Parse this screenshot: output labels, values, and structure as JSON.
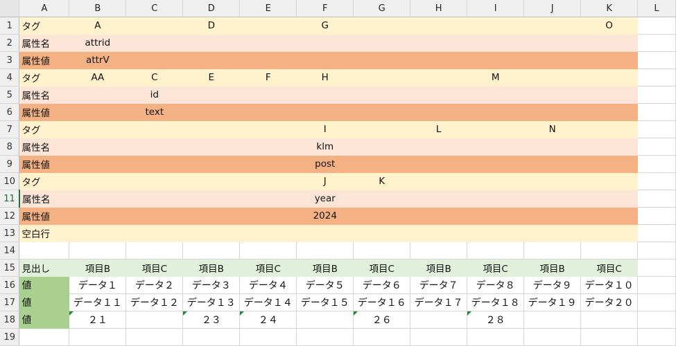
{
  "columns": [
    "A",
    "B",
    "C",
    "D",
    "E",
    "F",
    "G",
    "H",
    "I",
    "J",
    "K",
    "L"
  ],
  "bands": [
    "tag",
    "name",
    "val",
    "tag",
    "name",
    "val",
    "tag",
    "name",
    "val",
    "tag",
    "name",
    "val",
    "blank",
    "empty",
    "head",
    "data",
    "data",
    "data",
    "empty"
  ],
  "rows": [
    {
      "n": "1",
      "cells": [
        "タグ",
        "A",
        "",
        "D",
        "",
        "G",
        "",
        "",
        "",
        "",
        "O",
        ""
      ]
    },
    {
      "n": "2",
      "cells": [
        "属性名",
        "attrid",
        "",
        "",
        "",
        "",
        "",
        "",
        "",
        "",
        "",
        ""
      ]
    },
    {
      "n": "3",
      "cells": [
        "属性値",
        "attrV",
        "",
        "",
        "",
        "",
        "",
        "",
        "",
        "",
        "",
        ""
      ]
    },
    {
      "n": "4",
      "cells": [
        "タグ",
        "AA",
        "C",
        "E",
        "F",
        "H",
        "",
        "",
        "M",
        "",
        "",
        ""
      ]
    },
    {
      "n": "5",
      "cells": [
        "属性名",
        "",
        "id",
        "",
        "",
        "",
        "",
        "",
        "",
        "",
        "",
        ""
      ]
    },
    {
      "n": "6",
      "cells": [
        "属性値",
        "",
        "text",
        "",
        "",
        "",
        "",
        "",
        "",
        "",
        "",
        ""
      ]
    },
    {
      "n": "7",
      "cells": [
        "タグ",
        "",
        "",
        "",
        "",
        "I",
        "",
        "L",
        "",
        "N",
        "",
        ""
      ]
    },
    {
      "n": "8",
      "cells": [
        "属性名",
        "",
        "",
        "",
        "",
        "klm",
        "",
        "",
        "",
        "",
        "",
        ""
      ]
    },
    {
      "n": "9",
      "cells": [
        "属性値",
        "",
        "",
        "",
        "",
        "post",
        "",
        "",
        "",
        "",
        "",
        ""
      ]
    },
    {
      "n": "10",
      "cells": [
        "タグ",
        "",
        "",
        "",
        "",
        "J",
        "K",
        "",
        "",
        "",
        "",
        ""
      ]
    },
    {
      "n": "11",
      "cells": [
        "属性名",
        "",
        "",
        "",
        "",
        "year",
        "",
        "",
        "",
        "",
        "",
        ""
      ]
    },
    {
      "n": "12",
      "cells": [
        "属性値",
        "",
        "",
        "",
        "",
        "2024",
        "",
        "",
        "",
        "",
        "",
        ""
      ]
    },
    {
      "n": "13",
      "cells": [
        "空白行",
        "",
        "",
        "",
        "",
        "",
        "",
        "",
        "",
        "",
        "",
        ""
      ]
    },
    {
      "n": "14",
      "cells": [
        "",
        "",
        "",
        "",
        "",
        "",
        "",
        "",
        "",
        "",
        "",
        ""
      ]
    },
    {
      "n": "15",
      "cells": [
        "見出し",
        "項目B",
        "項目C",
        "項目B",
        "項目C",
        "項目B",
        "項目C",
        "項目B",
        "項目C",
        "項目B",
        "項目C",
        ""
      ]
    },
    {
      "n": "16",
      "cells": [
        "値",
        "データ１",
        "データ２",
        "データ３",
        "データ４",
        "データ５",
        "データ６",
        "データ７",
        "データ８",
        "データ９",
        "データ１０",
        ""
      ]
    },
    {
      "n": "17",
      "cells": [
        "値",
        "データ１１",
        "データ１２",
        "データ１３",
        "データ１４",
        "データ１５",
        "データ１６",
        "データ１７",
        "データ１８",
        "データ１９",
        "データ２０",
        ""
      ]
    },
    {
      "n": "18",
      "cells": [
        "値",
        "２１",
        "",
        "２３",
        "２４",
        "",
        "２６",
        "",
        "２８",
        "",
        "",
        ""
      ]
    },
    {
      "n": "19",
      "cells": [
        "",
        "",
        "",
        "",
        "",
        "",
        "",
        "",
        "",
        "",
        "",
        ""
      ]
    }
  ],
  "error_markers": [
    [
      17,
      1
    ],
    [
      17,
      3
    ],
    [
      17,
      4
    ],
    [
      17,
      6
    ],
    [
      17,
      8
    ]
  ],
  "selected_row": "11",
  "colors": {
    "tag": "#fff2cc",
    "name": "#fce4d6",
    "val": "#f4b183",
    "header": "#e2efda",
    "value_label": "#a9d08e",
    "marker": "#1f8a3a"
  }
}
